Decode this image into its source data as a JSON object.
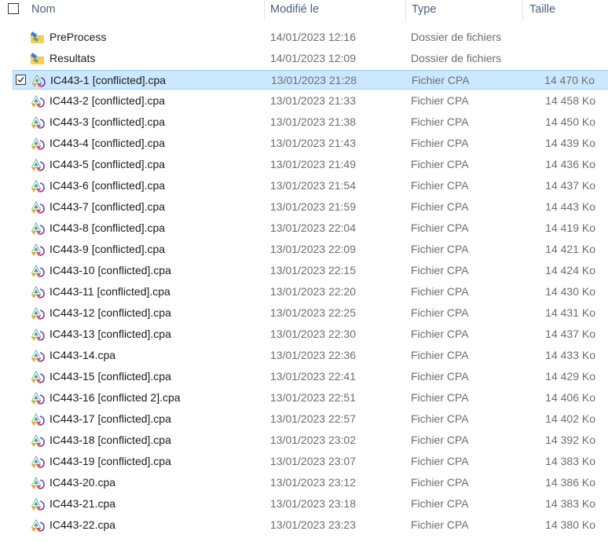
{
  "columns": {
    "name": "Nom",
    "modified": "Modifié le",
    "type": "Type",
    "size": "Taille"
  },
  "rows": [
    {
      "name": "PreProcess",
      "modified": "14/01/2023 12:16",
      "type": "Dossier de fichiers",
      "size": "",
      "icon": "folder-icon",
      "selected": false
    },
    {
      "name": "Resultats",
      "modified": "14/01/2023 12:09",
      "type": "Dossier de fichiers",
      "size": "",
      "icon": "folder-icon",
      "selected": false
    },
    {
      "name": "IC443-1 [conflicted].cpa",
      "modified": "13/01/2023 21:28",
      "type": "Fichier CPA",
      "size": "14 470 Ko",
      "icon": "cpa-file-icon",
      "selected": true
    },
    {
      "name": "IC443-2 [conflicted].cpa",
      "modified": "13/01/2023 21:33",
      "type": "Fichier CPA",
      "size": "14 458 Ko",
      "icon": "cpa-file-icon",
      "selected": false
    },
    {
      "name": "IC443-3 [conflicted].cpa",
      "modified": "13/01/2023 21:38",
      "type": "Fichier CPA",
      "size": "14 450 Ko",
      "icon": "cpa-file-icon",
      "selected": false
    },
    {
      "name": "IC443-4 [conflicted].cpa",
      "modified": "13/01/2023 21:43",
      "type": "Fichier CPA",
      "size": "14 439 Ko",
      "icon": "cpa-file-icon",
      "selected": false
    },
    {
      "name": "IC443-5 [conflicted].cpa",
      "modified": "13/01/2023 21:49",
      "type": "Fichier CPA",
      "size": "14 436 Ko",
      "icon": "cpa-file-icon",
      "selected": false
    },
    {
      "name": "IC443-6 [conflicted].cpa",
      "modified": "13/01/2023 21:54",
      "type": "Fichier CPA",
      "size": "14 437 Ko",
      "icon": "cpa-file-icon",
      "selected": false
    },
    {
      "name": "IC443-7 [conflicted].cpa",
      "modified": "13/01/2023 21:59",
      "type": "Fichier CPA",
      "size": "14 443 Ko",
      "icon": "cpa-file-icon",
      "selected": false
    },
    {
      "name": "IC443-8 [conflicted].cpa",
      "modified": "13/01/2023 22:04",
      "type": "Fichier CPA",
      "size": "14 419 Ko",
      "icon": "cpa-file-icon",
      "selected": false
    },
    {
      "name": "IC443-9 [conflicted].cpa",
      "modified": "13/01/2023 22:09",
      "type": "Fichier CPA",
      "size": "14 421 Ko",
      "icon": "cpa-file-icon",
      "selected": false
    },
    {
      "name": "IC443-10 [conflicted].cpa",
      "modified": "13/01/2023 22:15",
      "type": "Fichier CPA",
      "size": "14 424 Ko",
      "icon": "cpa-file-icon",
      "selected": false
    },
    {
      "name": "IC443-11 [conflicted].cpa",
      "modified": "13/01/2023 22:20",
      "type": "Fichier CPA",
      "size": "14 430 Ko",
      "icon": "cpa-file-icon",
      "selected": false
    },
    {
      "name": "IC443-12 [conflicted].cpa",
      "modified": "13/01/2023 22:25",
      "type": "Fichier CPA",
      "size": "14 431 Ko",
      "icon": "cpa-file-icon",
      "selected": false
    },
    {
      "name": "IC443-13 [conflicted].cpa",
      "modified": "13/01/2023 22:30",
      "type": "Fichier CPA",
      "size": "14 437 Ko",
      "icon": "cpa-file-icon",
      "selected": false
    },
    {
      "name": "IC443-14.cpa",
      "modified": "13/01/2023 22:36",
      "type": "Fichier CPA",
      "size": "14 433 Ko",
      "icon": "cpa-file-icon",
      "selected": false
    },
    {
      "name": "IC443-15 [conflicted].cpa",
      "modified": "13/01/2023 22:41",
      "type": "Fichier CPA",
      "size": "14 429 Ko",
      "icon": "cpa-file-icon",
      "selected": false
    },
    {
      "name": "IC443-16 [conflicted 2].cpa",
      "modified": "13/01/2023 22:51",
      "type": "Fichier CPA",
      "size": "14 406 Ko",
      "icon": "cpa-file-icon",
      "selected": false
    },
    {
      "name": "IC443-17 [conflicted].cpa",
      "modified": "13/01/2023 22:57",
      "type": "Fichier CPA",
      "size": "14 402 Ko",
      "icon": "cpa-file-icon",
      "selected": false
    },
    {
      "name": "IC443-18 [conflicted].cpa",
      "modified": "13/01/2023 23:02",
      "type": "Fichier CPA",
      "size": "14 392 Ko",
      "icon": "cpa-file-icon",
      "selected": false
    },
    {
      "name": "IC443-19 [conflicted].cpa",
      "modified": "13/01/2023 23:07",
      "type": "Fichier CPA",
      "size": "14 383 Ko",
      "icon": "cpa-file-icon",
      "selected": false
    },
    {
      "name": "IC443-20.cpa",
      "modified": "13/01/2023 23:12",
      "type": "Fichier CPA",
      "size": "14 386 Ko",
      "icon": "cpa-file-icon",
      "selected": false
    },
    {
      "name": "IC443-21.cpa",
      "modified": "13/01/2023 23:18",
      "type": "Fichier CPA",
      "size": "14 383 Ko",
      "icon": "cpa-file-icon",
      "selected": false
    },
    {
      "name": "IC443-22.cpa",
      "modified": "13/01/2023 23:23",
      "type": "Fichier CPA",
      "size": "14 380 Ko",
      "icon": "cpa-file-icon",
      "selected": false
    }
  ],
  "colors": {
    "selection_bg": "#cce8ff",
    "selection_border": "#99d1ff",
    "header_text": "#4c607a",
    "secondary_text": "#6d6d6d"
  }
}
